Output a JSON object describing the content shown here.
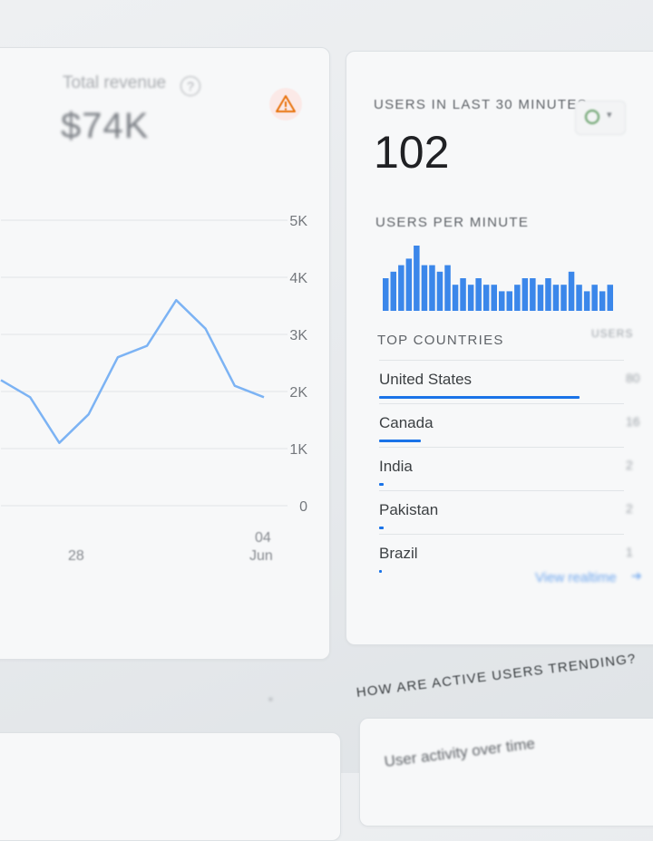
{
  "revenue": {
    "title": "Total revenue",
    "value": "$74K",
    "y_ticks": [
      "5K",
      "4K",
      "3K",
      "2K",
      "1K",
      "0"
    ],
    "x_labels": {
      "first": "28",
      "last_day": "04",
      "last_month": "Jun"
    },
    "series": [
      2.2,
      1.9,
      1.1,
      1.6,
      2.6,
      2.8,
      3.6,
      3.1,
      2.1,
      1.9
    ],
    "line_color": "#7cb3f4",
    "warning_color": "#e8710a"
  },
  "realtime": {
    "users_label": "USERS IN LAST 30 MINUTES",
    "users_value": "102",
    "per_minute_label": "USERS PER MINUTE",
    "per_minute": [
      5,
      6,
      7,
      8,
      10,
      7,
      7,
      6,
      7,
      4,
      5,
      4,
      5,
      4,
      4,
      3,
      3,
      4,
      5,
      5,
      4,
      5,
      4,
      4,
      6,
      4,
      3,
      4,
      3,
      4
    ],
    "bar_color": "#1a73e8",
    "top_countries_label": "TOP COUNTRIES",
    "users_col_label": "USERS",
    "countries": [
      {
        "name": "United States",
        "value": "80",
        "share": 0.82
      },
      {
        "name": "Canada",
        "value": "16",
        "share": 0.17
      },
      {
        "name": "India",
        "value": "2",
        "share": 0.02
      },
      {
        "name": "Pakistan",
        "value": "2",
        "share": 0.02
      },
      {
        "name": "Brazil",
        "value": "1",
        "share": 0.01
      }
    ],
    "view_link": "View realtime",
    "view_arrow": "➔"
  },
  "trends": {
    "heading": "HOW ARE ACTIVE USERS TRENDING?",
    "activity_title": "User activity over time",
    "dot": "•"
  }
}
